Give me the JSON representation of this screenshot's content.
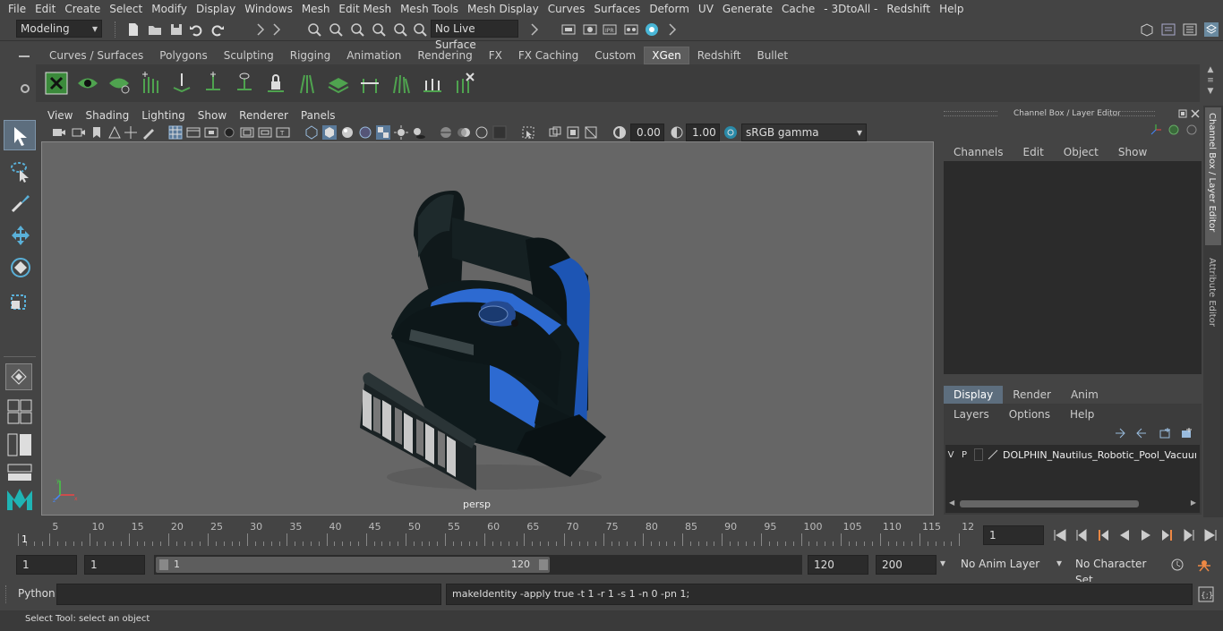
{
  "menubar": {
    "items": [
      "File",
      "Edit",
      "Create",
      "Select",
      "Modify",
      "Display",
      "Windows",
      "Mesh",
      "Edit Mesh",
      "Mesh Tools",
      "Mesh Display",
      "Curves",
      "Surfaces",
      "Deform",
      "UV",
      "Generate",
      "Cache",
      "- 3DtoAll -",
      "Redshift",
      "Help"
    ]
  },
  "statusline": {
    "mode": "Modeling",
    "live_surface": "No Live Surface"
  },
  "shelf": {
    "tabs": [
      "Curves / Surfaces",
      "Polygons",
      "Sculpting",
      "Rigging",
      "Animation",
      "Rendering",
      "FX",
      "FX Caching",
      "Custom",
      "XGen",
      "Redshift",
      "Bullet"
    ],
    "active": "XGen"
  },
  "viewport": {
    "menu": [
      "View",
      "Shading",
      "Lighting",
      "Show",
      "Renderer",
      "Panels"
    ],
    "exposure": "0.00",
    "gamma": "1.00",
    "color_space": "sRGB gamma",
    "camera_label": "persp"
  },
  "channelbox": {
    "title": "Channel Box / Layer Editor",
    "menu": [
      "Channels",
      "Edit",
      "Object",
      "Show"
    ],
    "layer_tabs": [
      "Display",
      "Render",
      "Anim"
    ],
    "active_layer_tab": "Display",
    "layer_menu": [
      "Layers",
      "Options",
      "Help"
    ],
    "layer": {
      "v": "V",
      "p": "P",
      "name": "DOLPHIN_Nautilus_Robotic_Pool_Vacuum_"
    }
  },
  "sidetabs": [
    "Channel Box / Layer Editor",
    "Attribute Editor"
  ],
  "timeline": {
    "ticks": [
      "5",
      "10",
      "15",
      "20",
      "25",
      "30",
      "35",
      "40",
      "45",
      "50",
      "55",
      "60",
      "65",
      "70",
      "75",
      "80",
      "85",
      "90",
      "95",
      "100",
      "105",
      "110",
      "115",
      "12"
    ],
    "start_marker": "1",
    "current_frame": "1"
  },
  "range": {
    "start": "1",
    "playback_start": "1",
    "slider_start": "1",
    "slider_end": "120",
    "playback_end": "120",
    "end": "200",
    "anim_layer": "No Anim Layer",
    "character_set": "No Character Set"
  },
  "cmdline": {
    "lang": "Python",
    "output": "makeIdentity -apply true -t 1 -r 1 -s 1 -n 0 -pn 1;"
  },
  "helpline": {
    "text": "Select Tool: select an object"
  }
}
